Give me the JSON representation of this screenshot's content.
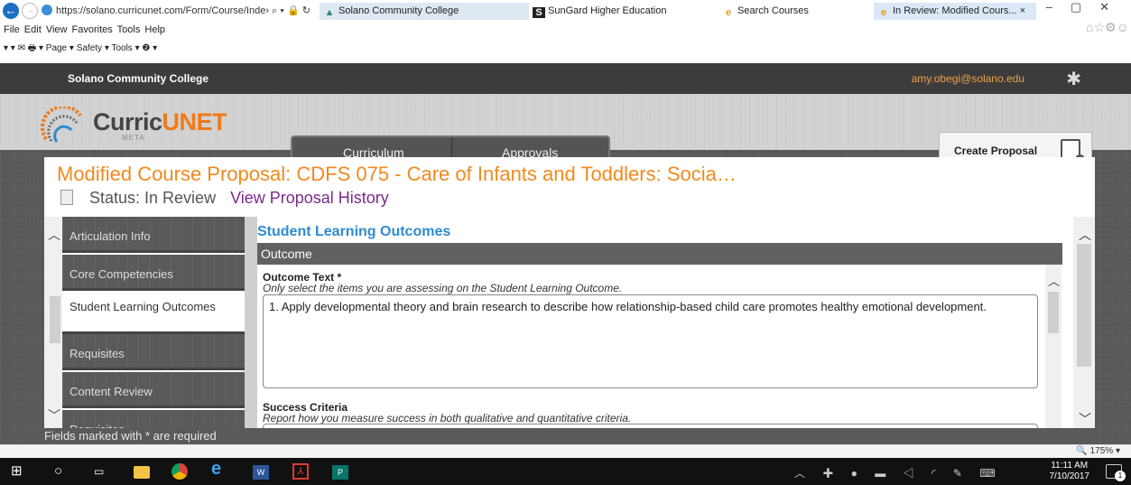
{
  "browser": {
    "url": "https://solano.curricunet.com/Form/Course/Inde›",
    "url_controls": "⌕ ▾ 🔒 ↻",
    "tabs": [
      {
        "label": "Solano Community College"
      },
      {
        "label": "SunGard Higher Education"
      },
      {
        "label": "Search Courses"
      },
      {
        "label": "In Review: Modified Cours... ×"
      }
    ],
    "menu": [
      "File",
      "Edit",
      "View",
      "Favorites",
      "Tools",
      "Help"
    ],
    "commandbar": "▾  ▾  ✉ 🖶 ▾  Page ▾  Safety ▾  Tools ▾  ❷ ▾",
    "zoom": "175%"
  },
  "app": {
    "college": "Solano Community College",
    "user_email": "amy.obegi@solano.edu",
    "logo_part1": "Curric",
    "logo_part2": "UNET",
    "logo_sub": "META",
    "nav": [
      "Curriculum",
      "Approvals"
    ],
    "create_proposal": "Create Proposal"
  },
  "proposal": {
    "title": "Modified Course Proposal: CDFS 075 - Care of Infants and Toddlers: Socia…",
    "status": "Status: In Review",
    "history_link": "View Proposal History"
  },
  "sidebar": {
    "items": [
      {
        "label": "Articulation Info"
      },
      {
        "label": "Core Competencies"
      },
      {
        "label": "Student Learning Outcomes"
      },
      {
        "label": "Requisites"
      },
      {
        "label": "Content Review"
      },
      {
        "label": "Requisites"
      }
    ]
  },
  "main": {
    "section_title": "Student Learning Outcomes",
    "outcome_header": "Outcome",
    "outcome_text_label": "Outcome Text *",
    "outcome_text_help": "Only select the items you are assessing on the Student Learning Outcome.",
    "outcome_text_value": "1. Apply developmental theory and brain research to describe how relationship-based child care promotes healthy emotional development.",
    "success_label": "Success Criteria",
    "success_help": "Report how you measure success in both qualitative and quantitative criteria."
  },
  "footer_note": "Fields marked with * are required",
  "taskbar": {
    "time": "11:11 AM",
    "date": "7/10/2017",
    "notifications": "1"
  },
  "colors": {
    "title_orange": "#f08a1e",
    "link_purple": "#7a2a8a",
    "section_blue": "#2f8ad0",
    "email_orange": "#f0a046"
  }
}
